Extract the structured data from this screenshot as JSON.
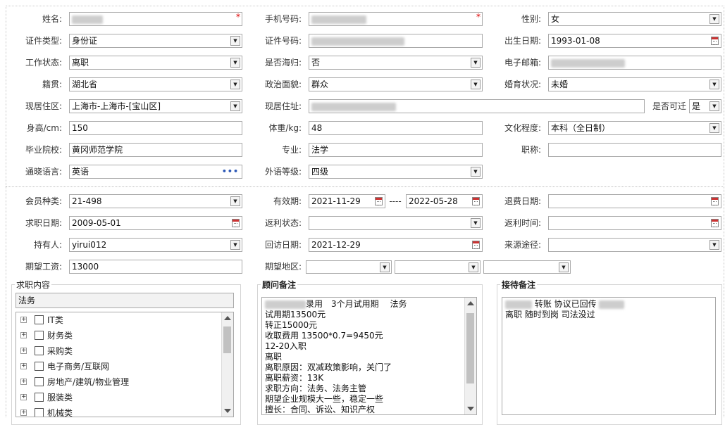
{
  "personal": {
    "name_label": "姓名:",
    "phone_label": "手机号码:",
    "gender_label": "性别:",
    "gender_value": "女",
    "id_type_label": "证件类型:",
    "id_type_value": "身份证",
    "id_number_label": "证件号码:",
    "birth_label": "出生日期:",
    "birth_value": "1993-01-08",
    "work_status_label": "工作状态:",
    "work_status_value": "离职",
    "overseas_label": "是否海归:",
    "overseas_value": "否",
    "email_label": "电子邮箱:",
    "hometown_label": "籍贯:",
    "hometown_value": "湖北省",
    "political_label": "政治面貌:",
    "political_value": "群众",
    "marital_label": "婚育状况:",
    "marital_value": "未婚",
    "residence_area_label": "现居住区:",
    "residence_area_value": "上海市-上海市-[宝山区]",
    "address_label": "现居住址:",
    "relocate_label": "是否可迁",
    "relocate_value": "是",
    "height_label": "身高/cm:",
    "height_value": "150",
    "weight_label": "体重/kg:",
    "weight_value": "48",
    "education_label": "文化程度:",
    "education_value": "本科（全日制）",
    "school_label": "毕业院校:",
    "school_value": "黄冈师范学院",
    "major_label": "专业:",
    "major_value": "法学",
    "title_label": "职称:",
    "title_value": "",
    "language_label": "通晓语言:",
    "language_value": "英语",
    "lang_level_label": "外语等级:",
    "lang_level_value": "四级"
  },
  "membership": {
    "member_type_label": "会员种类:",
    "member_type_value": "21-498",
    "valid_label": "有效期:",
    "valid_from": "2021-11-29",
    "valid_sep": "----",
    "valid_to": "2022-05-28",
    "refund_date_label": "退费日期:",
    "refund_date_value": "",
    "job_date_label": "求职日期:",
    "job_date_value": "2009-05-01",
    "rebate_status_label": "返利状态:",
    "rebate_status_value": "",
    "rebate_time_label": "返利时间:",
    "rebate_time_value": "",
    "holder_label": "持有人:",
    "holder_value": "yirui012",
    "visit_date_label": "回访日期:",
    "visit_date_value": "2021-12-29",
    "source_label": "来源途径:",
    "source_value": "",
    "salary_label": "期望工资:",
    "salary_value": "13000",
    "region_label": "期望地区:"
  },
  "job_content": {
    "legend": "求职内容",
    "search_value": "法务",
    "categories": [
      "IT类",
      "财务类",
      "采购类",
      "电子商务/互联网",
      "房地产/建筑/物业管理",
      "服装类",
      "机械类"
    ]
  },
  "advisor_notes": {
    "legend": "顾问备注",
    "lines": [
      "录用　3个月试用期　 法务",
      "试用期13500元",
      "转正15000元",
      "收取费用 13500*0.7=9450元",
      "12-20入职",
      "离职",
      "离职原因：双减政策影响，关门了",
      "离职薪资：13K",
      "求职方向：法务、法务主管",
      "期望企业规模大一些，稳定一些",
      "擅长：合同、诉讼、知识产权"
    ]
  },
  "reception_notes": {
    "legend": "接待备注",
    "line1_a": "转账 协议已回传",
    "line2": "离职 随时到岗 司法没过"
  },
  "icons": {
    "dropdown": "chevron-down-icon",
    "calendar": "calendar-icon",
    "more": "ellipsis-icon",
    "expand": "plus-box-icon"
  }
}
